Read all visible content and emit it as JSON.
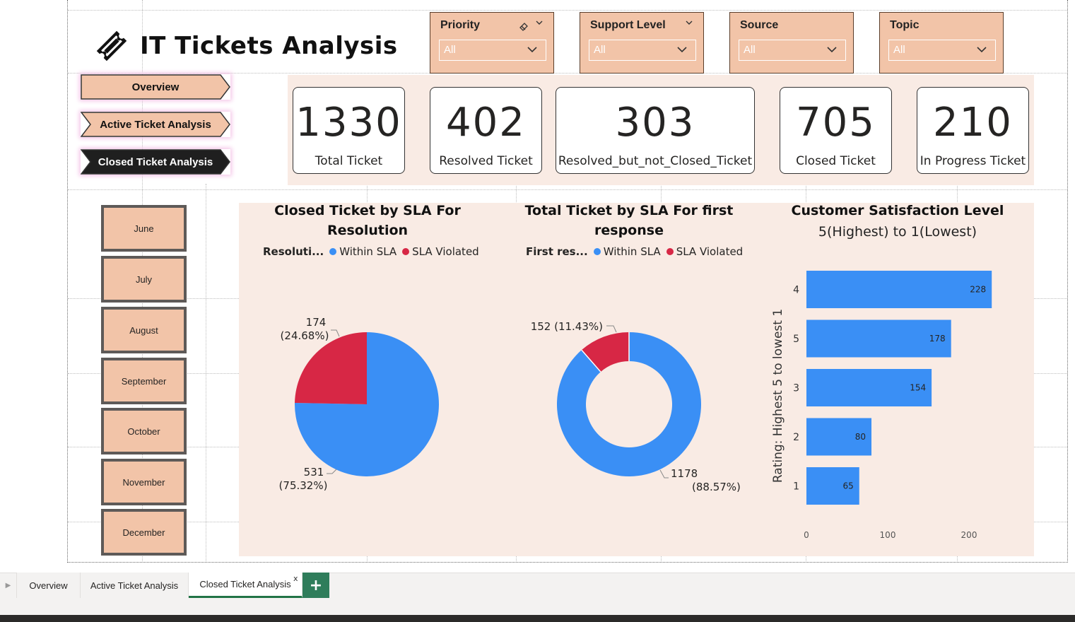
{
  "title": "IT Tickets Analysis",
  "slicers": [
    {
      "title": "Priority",
      "value": "All",
      "has_eraser": true
    },
    {
      "title": "Support Level",
      "value": "All",
      "has_eraser": false
    },
    {
      "title": "Source",
      "value": "All",
      "has_eraser": false
    },
    {
      "title": "Topic",
      "value": "All",
      "has_eraser": false
    }
  ],
  "nav": {
    "overview": "Overview",
    "active": "Active Ticket Analysis",
    "closed": "Closed Ticket Analysis",
    "selected": "Closed Ticket Analysis"
  },
  "kpis": [
    {
      "value": "1330",
      "label": "Total Ticket"
    },
    {
      "value": "402",
      "label": "Resolved Ticket"
    },
    {
      "value": "303",
      "label": "Resolved_but_not_Closed_Ticket"
    },
    {
      "value": "705",
      "label": "Closed Ticket"
    },
    {
      "value": "210",
      "label": "In Progress Ticket"
    }
  ],
  "months": [
    "June",
    "July",
    "August",
    "September",
    "October",
    "November",
    "December"
  ],
  "colors": {
    "within": "#3a8ff5",
    "violated": "#d72745",
    "bar": "#3a8ff5",
    "accent": "#f2c4a8",
    "panel": "#f9ebe4",
    "tab_active": "#217346",
    "add_tab": "#2f7d5b"
  },
  "chart_data": [
    {
      "type": "pie",
      "title": "Closed Ticket by SLA For Resolution",
      "legend_title": "Resoluti...",
      "legend": [
        "Within SLA",
        "SLA Violated"
      ],
      "slices": [
        {
          "name": "Within SLA",
          "value": 531,
          "pct": "75.32%",
          "label_line1": "531",
          "label_line2": "(75.32%)"
        },
        {
          "name": "SLA Violated",
          "value": 174,
          "pct": "24.68%",
          "label_line1": "174",
          "label_line2": "(24.68%)"
        }
      ]
    },
    {
      "type": "pie",
      "donut": true,
      "title": "Total Ticket by SLA For first response",
      "legend_title": "First res...",
      "legend": [
        "Within SLA",
        "SLA Violated"
      ],
      "slices": [
        {
          "name": "Within SLA",
          "value": 1178,
          "pct": "88.57%",
          "label_line1": "1178",
          "label_line2": "(88.57%)"
        },
        {
          "name": "SLA Violated",
          "value": 152,
          "pct": "11.43%",
          "label_line1": "152 (11.43%)",
          "label_line2": ""
        }
      ]
    },
    {
      "type": "bar",
      "orientation": "horizontal",
      "title": "Customer Satisfaction Level",
      "subtitle": "5(Highest) to 1(Lowest)",
      "ylabel": "Rating: Highest 5 to lowest 1",
      "xlabel": "",
      "categories": [
        "4",
        "5",
        "3",
        "2",
        "1"
      ],
      "values": [
        228,
        178,
        154,
        80,
        65
      ],
      "xlim": [
        0,
        250
      ],
      "xticks": [
        "0",
        "100",
        "200"
      ]
    }
  ],
  "tabs": [
    "Overview",
    "Active Ticket Analysis",
    "Closed Ticket Analysis"
  ],
  "active_tab": "Closed Ticket Analysis",
  "add_tab_label": "+",
  "close_tab_label": "x"
}
